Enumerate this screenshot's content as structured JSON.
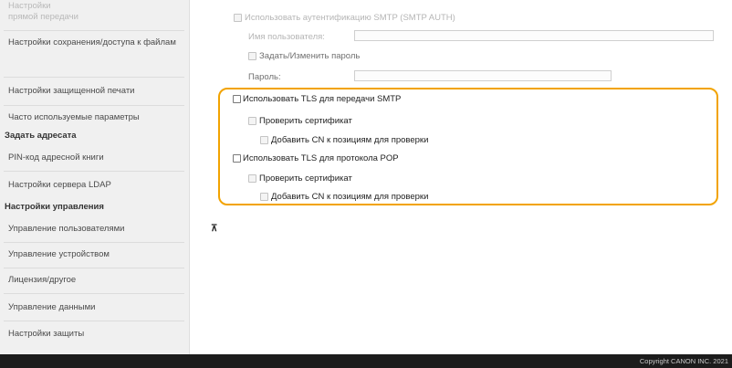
{
  "sidebar": {
    "items": [
      {
        "label": "Настройки",
        "faded": true
      },
      {
        "label": "прямой передачи",
        "faded": true
      },
      {
        "label": "Настройки сохранения/доступа к файлам",
        "faded": false
      },
      {
        "label": "Настройки защищенной печати",
        "faded": false
      },
      {
        "label": "Часто используемые параметры",
        "faded": false
      }
    ],
    "section_recipient": "Задать адресата",
    "recipient_items": [
      "PIN-код адресной книги",
      "Настройки сервера LDAP"
    ],
    "section_management": "Настройки управления",
    "management_items": [
      "Управление пользователями",
      "Управление устройством",
      "Лицензия/другое",
      "Управление данными",
      "Настройки защиты"
    ]
  },
  "main": {
    "smtp_auth_label": "Использовать аутентификацию SMTP (SMTP AUTH)",
    "username_label": "Имя пользователя:",
    "username_value": "",
    "set_password_label": "Задать/Изменить пароль",
    "password_label": "Пароль:",
    "password_value": "",
    "tls_smtp_label": "Использовать TLS для передачи SMTP",
    "verify_cert_label_1": "Проверить сертификат",
    "add_cn_label_1": "Добавить CN к позициям для проверки",
    "tls_pop_label": "Использовать TLS для протокола POP",
    "verify_cert_label_2": "Проверить сертификат",
    "add_cn_label_2": "Добавить CN к позициям для проверки",
    "back_to_top_glyph": "⊼"
  },
  "footer": {
    "copyright": "Copyright CANON INC. 2021"
  },
  "colors": {
    "highlight": "#f2a300",
    "sidebar_bg": "#f0f0f0",
    "footer_bg": "#1c1c1c"
  }
}
